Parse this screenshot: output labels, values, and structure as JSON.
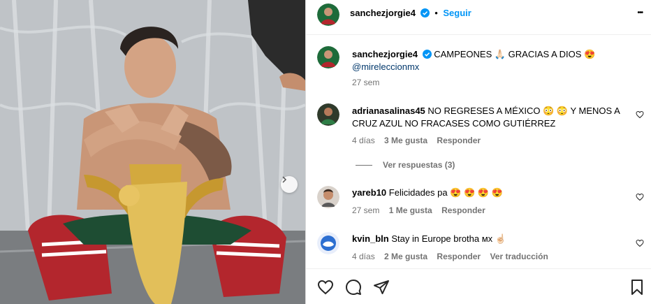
{
  "post": {
    "username": "sanchezjorgie4",
    "follow_label": "Seguir",
    "dot": "•",
    "more_label": "•••",
    "caption_text": "CAMPEONES 🙏🏻 GRACIAS A DIOS 😍",
    "caption_mention": "@mireleccionmx",
    "caption_time": "27 sem"
  },
  "comments": [
    {
      "username": "adrianasalinas45",
      "text": "NO REGRESES A MÉXICO 😳 😳  Y MENOS A CRUZ AZUL NO FRACASES COMO GUTIÉRREZ",
      "time": "4 días",
      "likes": "3 Me gusta",
      "reply": "Responder",
      "view_replies": "Ver respuestas (3)"
    },
    {
      "username": "yareb10",
      "text": "Felicidades pa 😍 😍 😍 😍",
      "time": "27 sem",
      "likes": "1 Me gusta",
      "reply": "Responder"
    },
    {
      "username": "kvin_bln",
      "text": "Stay in Europe brotha мх ☝🏻",
      "time": "4 días",
      "likes": "2 Me gusta",
      "reply": "Responder",
      "translate": "Ver traducción"
    }
  ],
  "icons": {
    "like": "heart-icon",
    "comment": "comment-icon",
    "share": "share-icon",
    "save": "bookmark-icon",
    "verified": "verified-badge-icon",
    "next": "chevron-right-icon"
  },
  "colors": {
    "link": "#00376b",
    "follow": "#0095f6",
    "meta": "#737373",
    "verified": "#0095f6"
  }
}
